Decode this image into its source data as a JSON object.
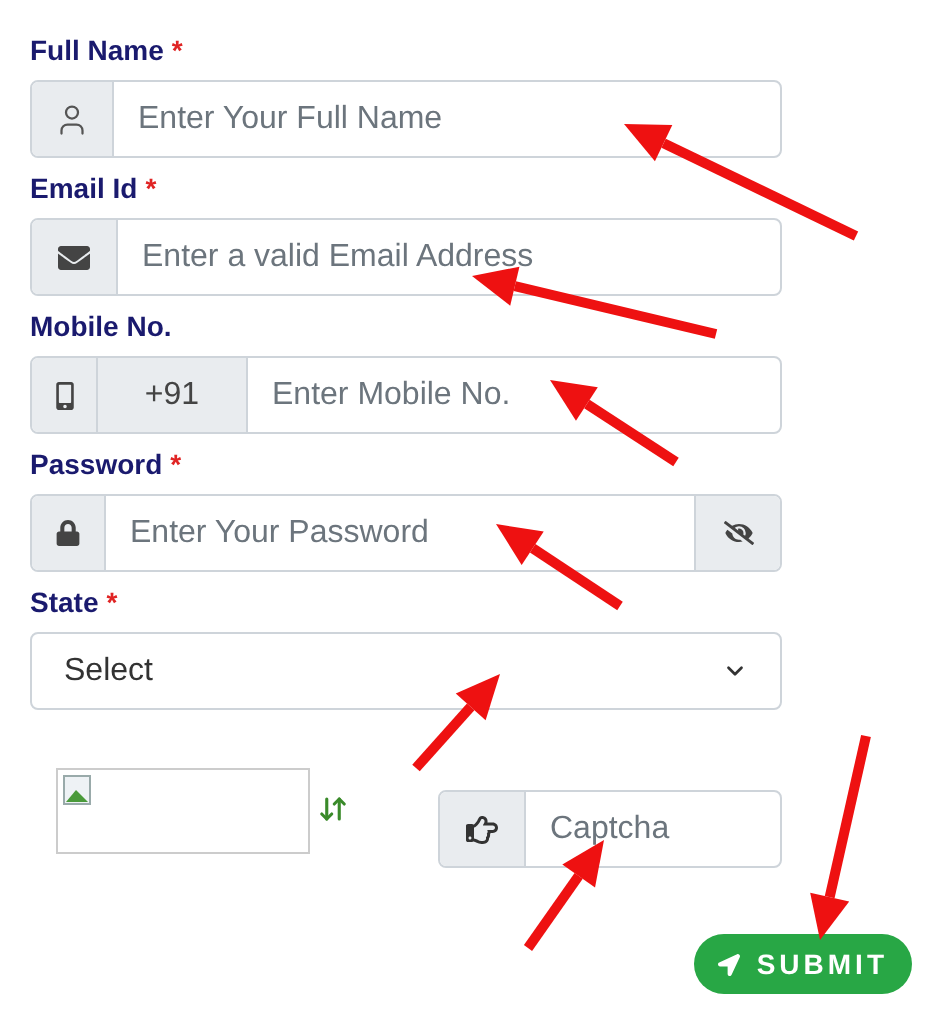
{
  "fields": [
    {
      "kind": "text",
      "label": "Full Name",
      "required_mark": "*",
      "placeholder": "Enter Your Full Name"
    },
    {
      "kind": "email",
      "label": "Email Id",
      "required_mark": "*",
      "placeholder": "Enter a valid Email Address"
    },
    {
      "kind": "mobile",
      "label": "Mobile No.",
      "prefix": "+91",
      "placeholder": "Enter Mobile No."
    },
    {
      "kind": "password",
      "label": "Password",
      "required_mark": "*",
      "placeholder": "Enter Your Password"
    },
    {
      "kind": "select",
      "label": "State",
      "required_mark": "*",
      "value": "Select"
    }
  ],
  "captcha": {
    "placeholder": "Captcha"
  },
  "submit": {
    "label": "SUBMIT"
  }
}
